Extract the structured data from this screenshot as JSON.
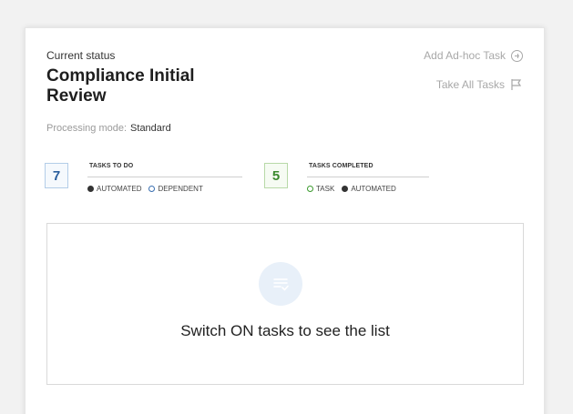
{
  "status": {
    "label": "Current status",
    "title": "Compliance Initial Review",
    "mode_label": "Processing mode:",
    "mode_value": "Standard"
  },
  "actions": {
    "add_adhoc": "Add Ad-hoc Task",
    "take_all": "Take All Tasks"
  },
  "stats": {
    "todo": {
      "count": "7",
      "title": "TASKS TO DO",
      "legend": [
        "AUTOMATED",
        "DEPENDENT"
      ]
    },
    "completed": {
      "count": "5",
      "title": "TASKS COMPLETED",
      "legend": [
        "TASK",
        "AUTOMATED"
      ]
    }
  },
  "empty_state": {
    "message": "Switch ON tasks to see the list"
  },
  "colors": {
    "todo_accent": "#2b5f9e",
    "done_accent": "#3b8a2d",
    "muted": "#a8a8a8"
  }
}
